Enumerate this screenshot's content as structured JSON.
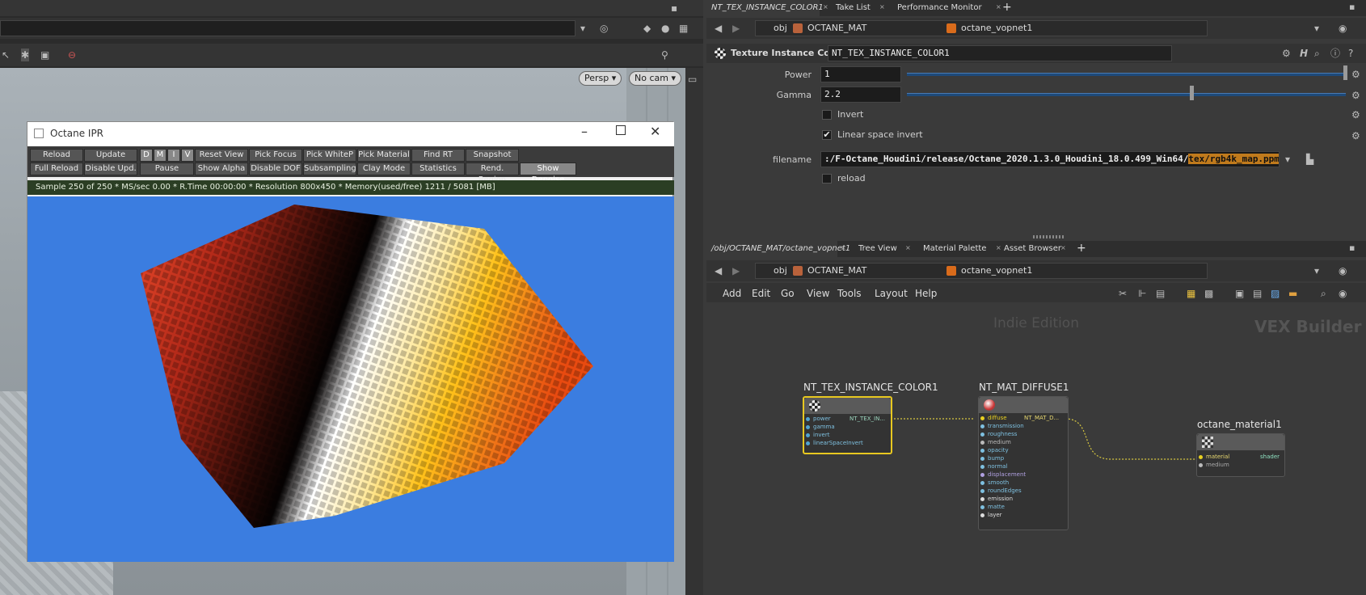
{
  "viewport": {
    "persp_label": "Persp",
    "cam_label": "No cam"
  },
  "ipr": {
    "title": "Octane IPR",
    "row1": [
      "Reload",
      "Update",
      "D",
      "M",
      "I",
      "V",
      "Reset View",
      "Pick Focus",
      "Pick WhiteP",
      "Pick Material",
      "Find RT",
      "Snapshot"
    ],
    "row2": [
      "Full Reload",
      "Disable Upd.",
      "Pause",
      "Show Alpha",
      "Disable DOF",
      "Subsampling",
      "Clay Mode",
      "Statistics",
      "Rend. Region",
      "Show Denoise"
    ],
    "status": "Sample 250 of 250 * MS/sec 0.00 * R.Time 00:00:00 * Resolution 800x450 * Memory(used/free) 1211 / 5081 [MB]"
  },
  "top_tabs": [
    "NT_TEX_INSTANCE_COLOR1",
    "Take List",
    "Performance Monitor"
  ],
  "path": {
    "obj": "obj",
    "mat": "OCTANE_MAT",
    "vopnet": "octane_vopnet1"
  },
  "params": {
    "node_type": "Texture Instance Color",
    "node_name": "NT_TEX_INSTANCE_COLOR1",
    "power_label": "Power",
    "power_value": "1",
    "gamma_label": "Gamma",
    "gamma_value": "2.2",
    "invert_label": "Invert",
    "linear_label": "Linear space invert",
    "filename_label": "filename",
    "filename_value": ":/F-Octane_Houdini/release/Octane_2020.1.3.0_Houdini_18.0.499_Win64/",
    "filename_highlight": "tex/rgb4k_map.ppm",
    "reload_label": "reload"
  },
  "net_tabs": [
    "/obj/OCTANE_MAT/octane_vopnet1",
    "Tree View",
    "Material Palette",
    "Asset Browser"
  ],
  "net_menu": [
    "Add",
    "Edit",
    "Go",
    "View",
    "Tools",
    "Layout",
    "Help"
  ],
  "network": {
    "watermark_left": "Indie Edition",
    "watermark_right": "VEX Builder",
    "node1": {
      "title": "NT_TEX_INSTANCE_COLOR1",
      "inputs": [
        "power",
        "gamma",
        "invert",
        "linearSpaceInvert"
      ],
      "output": "NT_TEX_IN..."
    },
    "node2": {
      "title": "NT_MAT_DIFFUSE1",
      "inputs": [
        "diffuse",
        "transmission",
        "roughness",
        "medium",
        "opacity",
        "bump",
        "normal",
        "displacement",
        "smooth",
        "roundEdges",
        "emission",
        "matte",
        "layer"
      ],
      "output": "NT_MAT_D..."
    },
    "node3": {
      "title": "octane_material1",
      "inputs": [
        "material",
        "medium"
      ],
      "output": "shader"
    }
  }
}
